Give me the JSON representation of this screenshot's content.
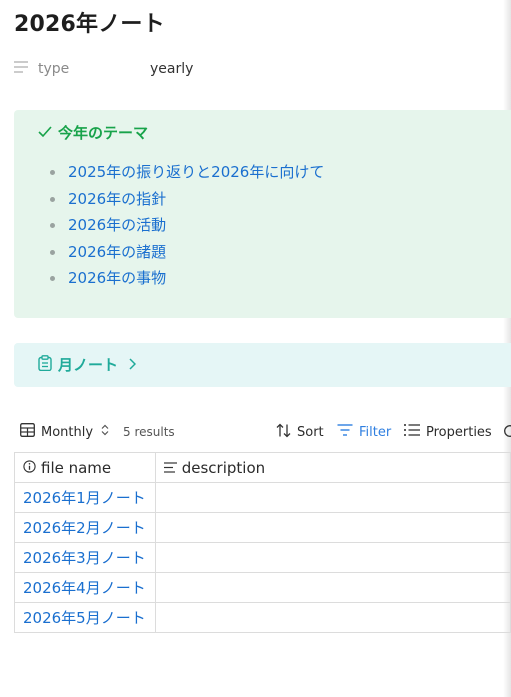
{
  "page": {
    "title": "2026年ノート"
  },
  "property": {
    "name": "type",
    "value": "yearly"
  },
  "callout": {
    "title": "今年のテーマ",
    "items": [
      "2025年の振り返りと2026年に向けて",
      "2026年の指針",
      "2026年の活動",
      "2026年の諸題",
      "2026年の事物"
    ]
  },
  "month_link": {
    "label": "月ノート"
  },
  "view": {
    "name": "Monthly",
    "result_count": "5 results",
    "sort_label": "Sort",
    "filter_label": "Filter",
    "properties_label": "Properties"
  },
  "table": {
    "columns": [
      "file name",
      "description"
    ],
    "rows": [
      {
        "file_name": "2026年1月ノート",
        "description": ""
      },
      {
        "file_name": "2026年2月ノート",
        "description": ""
      },
      {
        "file_name": "2026年3月ノート",
        "description": ""
      },
      {
        "file_name": "2026年4月ノート",
        "description": ""
      },
      {
        "file_name": "2026年5月ノート",
        "description": ""
      }
    ]
  },
  "icons": {
    "property": "text-lines-icon",
    "callout": "check-icon",
    "month_link": "clipboard-icon",
    "view": "table-icon",
    "view_switch": "chevron-updown-icon",
    "sort": "sort-arrows-icon",
    "filter": "filter-icon",
    "properties": "list-icon",
    "file_name_column": "info-icon",
    "description_column": "text-align-icon"
  },
  "colors": {
    "link": "#1a6fcf",
    "callout_accent": "#18a34a",
    "callout_bg": "#e6f5ec",
    "month_accent": "#1faa9a",
    "filter": "#2f7fe0"
  }
}
